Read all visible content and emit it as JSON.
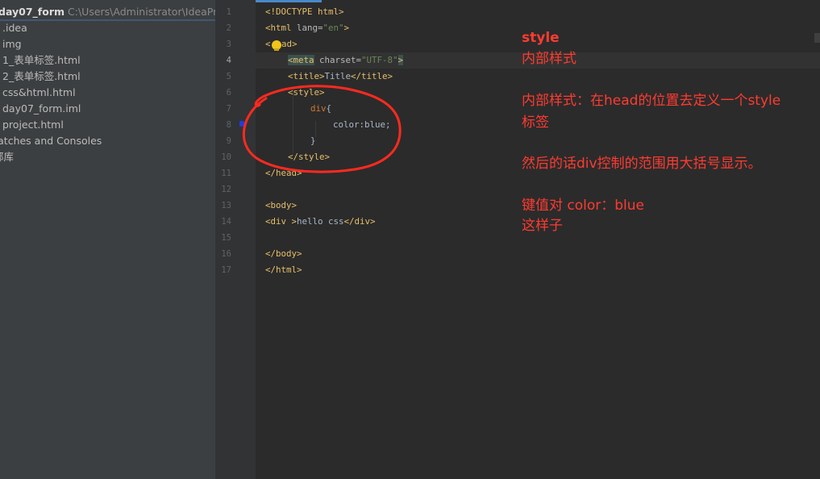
{
  "project": {
    "root_name": "day07_form",
    "root_path": "C:\\Users\\Administrator\\IdeaProject",
    "items": [
      ".idea",
      "img",
      "1_表单标签.html",
      "2_表单标签.html",
      "css&html.html",
      "day07_form.iml",
      "project.html",
      "ratches and Consoles",
      "部库"
    ]
  },
  "editor": {
    "line_numbers": [
      "1",
      "2",
      "3",
      "4",
      "5",
      "6",
      "7",
      "8",
      "9",
      "10",
      "11",
      "12",
      "13",
      "14",
      "15",
      "16",
      "17"
    ],
    "active_line": "4",
    "code": {
      "l1": "<!DOCTYPE html>",
      "l2_tag_open": "<html ",
      "l2_attr": "lang=",
      "l2_str": "\"en\"",
      "l2_tag_close": ">",
      "l3_lt": "<",
      "l3_rest": "ead>",
      "l4_tag_open": "<meta",
      "l4_attr": " charset=",
      "l4_str": "\"UTF-8\"",
      "l4_tag_close": ">",
      "l5_open": "<title>",
      "l5_text": "Title",
      "l5_close": "</title>",
      "l6": "<style>",
      "l7_sel": "div",
      "l7_brace": "{",
      "l8_prop": "color",
      "l8_rest": ":blue;",
      "l9": "}",
      "l10": "</style>",
      "l11": "</head>",
      "l13": "<body>",
      "l14_open": "<div >",
      "l14_text": "hello css",
      "l14_close": "</div>",
      "l16": "</body>",
      "l17": "</html>"
    }
  },
  "annotations": {
    "a1": "style",
    "a2": "内部样式",
    "a3": "内部样式：在head的位置去定义一个style",
    "a4": "标签",
    "a5": "然后的话div控制的范围用大括号显示。",
    "a6": "键值对  color：blue",
    "a7": "这样子"
  },
  "colors": {
    "annotation": "#ff3b30",
    "tag": "#e8bf6a",
    "string": "#6a8759",
    "selector": "#cc7832"
  }
}
